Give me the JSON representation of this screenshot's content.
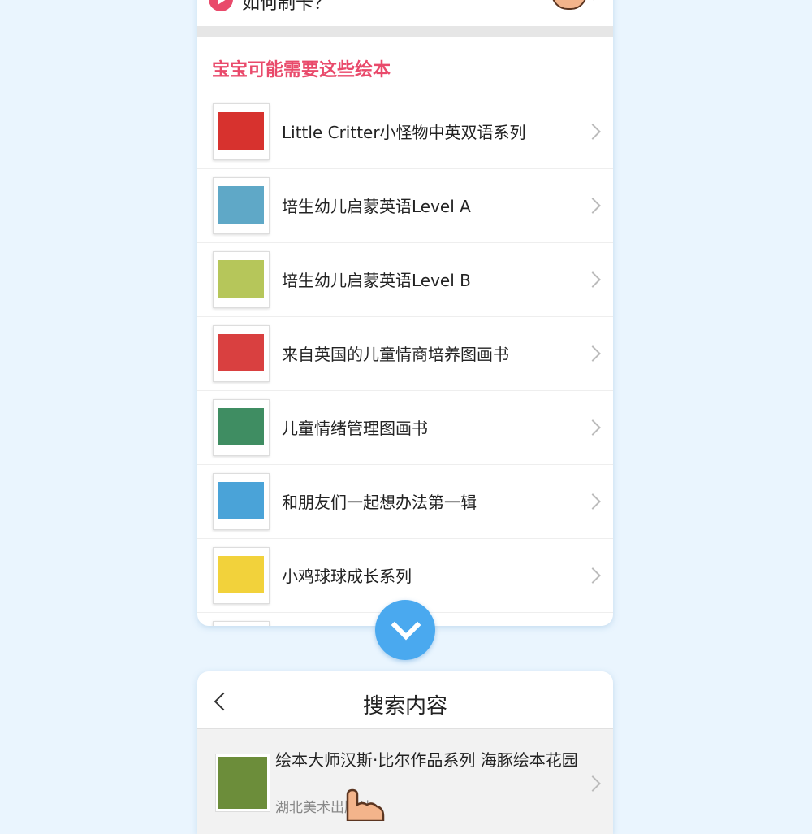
{
  "howto": {
    "label": "如何制卡？"
  },
  "section": {
    "title": "宝宝可能需要这些绘本"
  },
  "books": [
    {
      "title": "Little Critter小怪物中英双语系列",
      "cover_color": "#d7322e"
    },
    {
      "title": "培生幼儿启蒙英语Level A",
      "cover_color": "#5fa8c7"
    },
    {
      "title": "培生幼儿启蒙英语Level B",
      "cover_color": "#b6c65a"
    },
    {
      "title": "来自英国的儿童情商培养图画书",
      "cover_color": "#d94040"
    },
    {
      "title": "儿童情绪管理图画书",
      "cover_color": "#3f8d62"
    },
    {
      "title": "和朋友们一起想办法第一辑",
      "cover_color": "#4aa3d8"
    },
    {
      "title": "小鸡球球成长系列",
      "cover_color": "#f2d23b"
    }
  ],
  "search": {
    "title": "搜索内容",
    "result": {
      "title": "绘本大师汉斯·比尔作品系列 海豚绘本花园",
      "publisher": "湖北美术出版社"
    }
  },
  "colors": {
    "accent": "#e94a6b",
    "button": "#4aa9ef",
    "background": "#eaf5fe"
  }
}
